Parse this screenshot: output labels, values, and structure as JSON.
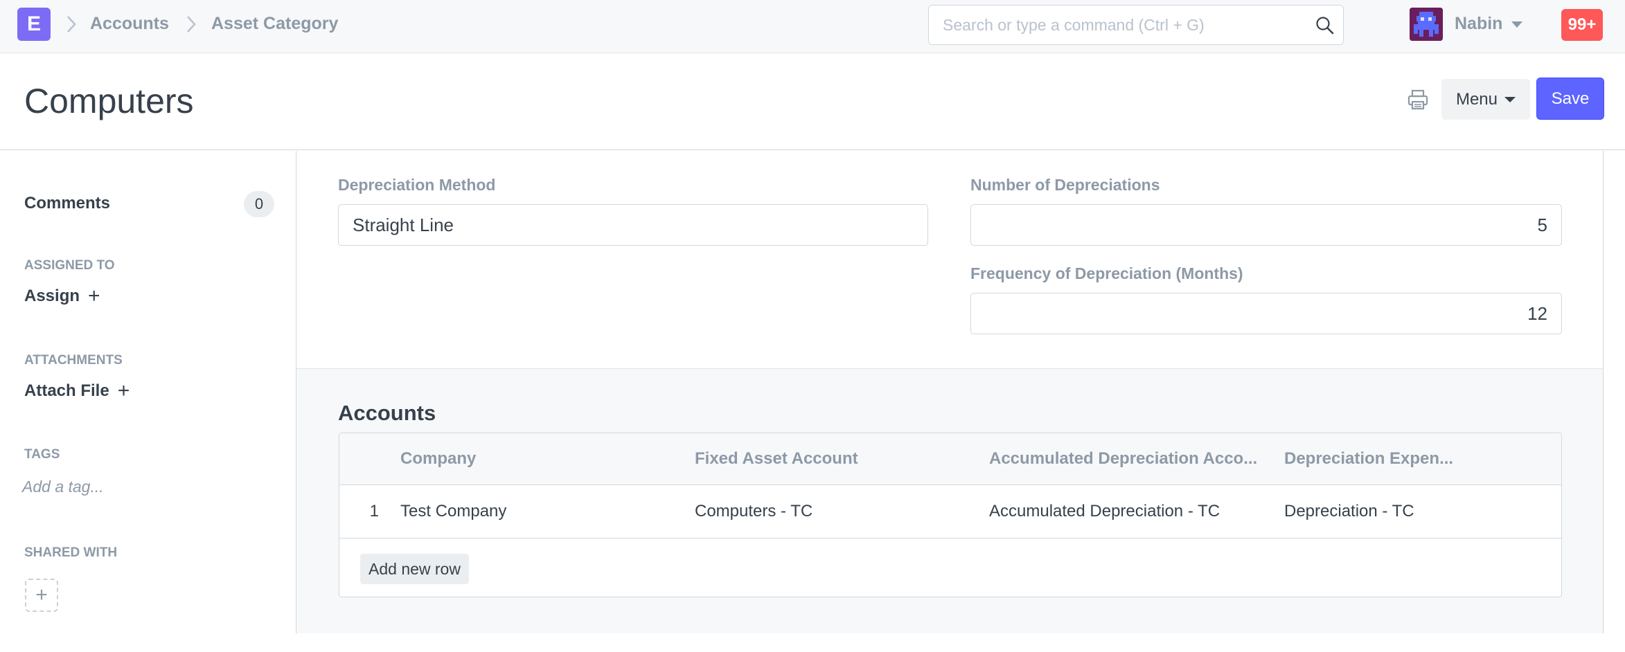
{
  "navbar": {
    "logo_letter": "E",
    "breadcrumbs": [
      "Accounts",
      "Asset Category"
    ],
    "search_placeholder": "Search or type a command (Ctrl + G)",
    "user_name": "Nabin",
    "notification_count": "99+"
  },
  "page": {
    "title": "Computers",
    "menu_label": "Menu",
    "save_label": "Save"
  },
  "sidebar": {
    "comments_label": "Comments",
    "comments_count": "0",
    "assigned_to_label": "ASSIGNED TO",
    "assign_label": "Assign",
    "attachments_label": "ATTACHMENTS",
    "attach_label": "Attach File",
    "tags_label": "TAGS",
    "tag_placeholder": "Add a tag...",
    "shared_with_label": "SHARED WITH"
  },
  "form": {
    "depreciation_method_label": "Depreciation Method",
    "depreciation_method_value": "Straight Line",
    "num_depreciations_label": "Number of Depreciations",
    "num_depreciations_value": "5",
    "frequency_label": "Frequency of Depreciation (Months)",
    "frequency_value": "12"
  },
  "accounts": {
    "title": "Accounts",
    "columns": [
      "Company",
      "Fixed Asset Account",
      "Accumulated Depreciation Acco...",
      "Depreciation Expen..."
    ],
    "rows": [
      {
        "idx": "1",
        "company": "Test Company",
        "fixed_asset_account": "Computers - TC",
        "accumulated_depreciation_account": "Accumulated Depreciation - TC",
        "depreciation_expense_account": "Depreciation - TC"
      }
    ],
    "add_row_label": "Add new row"
  },
  "colors": {
    "primary": "#5e64ff",
    "logo": "#7c6cf5",
    "notification": "#ff5858",
    "muted_text": "#8d99a6"
  }
}
